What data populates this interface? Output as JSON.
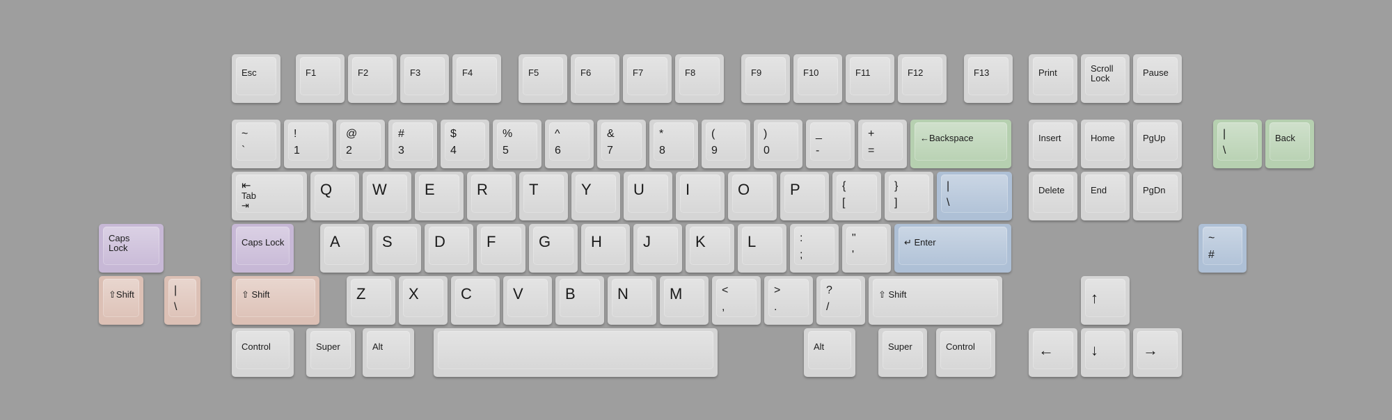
{
  "colors": {
    "background": "#9e9e9e",
    "key_gray": "#d5d5d5",
    "key_green": "#b6d0b0",
    "key_blue": "#aec0d6",
    "key_purple": "#c7b8d6",
    "key_peach": "#dcc0b5",
    "legend": "#1a1a1a"
  },
  "keys": [
    {
      "name": "esc",
      "label": "Esc",
      "color": "gray"
    },
    {
      "name": "f1",
      "label": "F1",
      "color": "gray"
    },
    {
      "name": "f2",
      "label": "F2",
      "color": "gray"
    },
    {
      "name": "f3",
      "label": "F3",
      "color": "gray"
    },
    {
      "name": "f4",
      "label": "F4",
      "color": "gray"
    },
    {
      "name": "f5",
      "label": "F5",
      "color": "gray"
    },
    {
      "name": "f6",
      "label": "F6",
      "color": "gray"
    },
    {
      "name": "f7",
      "label": "F7",
      "color": "gray"
    },
    {
      "name": "f8",
      "label": "F8",
      "color": "gray"
    },
    {
      "name": "f9",
      "label": "F9",
      "color": "gray"
    },
    {
      "name": "f10",
      "label": "F10",
      "color": "gray"
    },
    {
      "name": "f11",
      "label": "F11",
      "color": "gray"
    },
    {
      "name": "f12",
      "label": "F12",
      "color": "gray"
    },
    {
      "name": "f13",
      "label": "F13",
      "color": "gray"
    },
    {
      "name": "print",
      "label": "Print",
      "color": "gray"
    },
    {
      "name": "scroll-lock",
      "label": "Scroll\nLock",
      "color": "gray"
    },
    {
      "name": "pause",
      "label": "Pause",
      "color": "gray"
    },
    {
      "name": "tilde",
      "top": "~",
      "bottom": "`",
      "color": "gray"
    },
    {
      "name": "1",
      "top": "!",
      "bottom": "1",
      "color": "gray"
    },
    {
      "name": "2",
      "top": "@",
      "bottom": "2",
      "color": "gray"
    },
    {
      "name": "3",
      "top": "#",
      "bottom": "3",
      "color": "gray"
    },
    {
      "name": "4",
      "top": "$",
      "bottom": "4",
      "color": "gray"
    },
    {
      "name": "5",
      "top": "%",
      "bottom": "5",
      "color": "gray"
    },
    {
      "name": "6",
      "top": "^",
      "bottom": "6",
      "color": "gray"
    },
    {
      "name": "7",
      "top": "&",
      "bottom": "7",
      "color": "gray"
    },
    {
      "name": "8",
      "top": "*",
      "bottom": "8",
      "color": "gray"
    },
    {
      "name": "9",
      "top": "(",
      "bottom": "9",
      "color": "gray"
    },
    {
      "name": "0",
      "top": ")",
      "bottom": "0",
      "color": "gray"
    },
    {
      "name": "minus",
      "top": "_",
      "bottom": "-",
      "color": "gray"
    },
    {
      "name": "equal",
      "top": "+",
      "bottom": "=",
      "color": "gray"
    },
    {
      "name": "backspace",
      "label": "←Backspace",
      "color": "green"
    },
    {
      "name": "insert",
      "label": "Insert",
      "color": "gray"
    },
    {
      "name": "home",
      "label": "Home",
      "color": "gray"
    },
    {
      "name": "pgup",
      "label": "PgUp",
      "color": "gray"
    },
    {
      "name": "split-backslash",
      "top": "|",
      "bottom": "\\",
      "color": "green"
    },
    {
      "name": "back",
      "label": "Back",
      "color": "green"
    },
    {
      "name": "tab",
      "top": "⇤",
      "bottom": "Tab\n⇥",
      "color": "gray"
    },
    {
      "name": "q",
      "label": "Q",
      "color": "gray"
    },
    {
      "name": "w",
      "label": "W",
      "color": "gray"
    },
    {
      "name": "e",
      "label": "E",
      "color": "gray"
    },
    {
      "name": "r",
      "label": "R",
      "color": "gray"
    },
    {
      "name": "t",
      "label": "T",
      "color": "gray"
    },
    {
      "name": "y",
      "label": "Y",
      "color": "gray"
    },
    {
      "name": "u",
      "label": "U",
      "color": "gray"
    },
    {
      "name": "i",
      "label": "I",
      "color": "gray"
    },
    {
      "name": "o",
      "label": "O",
      "color": "gray"
    },
    {
      "name": "p",
      "label": "P",
      "color": "gray"
    },
    {
      "name": "lbracket",
      "top": "{",
      "bottom": "[",
      "color": "gray"
    },
    {
      "name": "rbracket",
      "top": "}",
      "bottom": "]",
      "color": "gray"
    },
    {
      "name": "backslash",
      "top": "|",
      "bottom": "\\",
      "color": "blue"
    },
    {
      "name": "delete",
      "label": "Delete",
      "color": "gray"
    },
    {
      "name": "end",
      "label": "End",
      "color": "gray"
    },
    {
      "name": "pgdn",
      "label": "PgDn",
      "color": "gray"
    },
    {
      "name": "iso-enter",
      "label": "Enter\n↵",
      "color": "blue"
    },
    {
      "name": "caps-lock-alt",
      "label": "Caps\nLock",
      "color": "purple"
    },
    {
      "name": "caps-lock",
      "label": "Caps Lock",
      "color": "purple"
    },
    {
      "name": "a",
      "label": "A",
      "color": "gray"
    },
    {
      "name": "s",
      "label": "S",
      "color": "gray"
    },
    {
      "name": "d",
      "label": "D",
      "color": "gray"
    },
    {
      "name": "f",
      "label": "F",
      "color": "gray"
    },
    {
      "name": "g",
      "label": "G",
      "color": "gray"
    },
    {
      "name": "h",
      "label": "H",
      "color": "gray"
    },
    {
      "name": "j",
      "label": "J",
      "color": "gray"
    },
    {
      "name": "k",
      "label": "K",
      "color": "gray"
    },
    {
      "name": "l",
      "label": "L",
      "color": "gray"
    },
    {
      "name": "semicolon",
      "top": ":",
      "bottom": ";",
      "color": "gray"
    },
    {
      "name": "quote",
      "top": "\"",
      "bottom": "'",
      "color": "gray"
    },
    {
      "name": "enter",
      "label": "↵ Enter",
      "color": "blue"
    },
    {
      "name": "iso-hash",
      "top": "~",
      "bottom": "#",
      "color": "blue"
    },
    {
      "name": "shift-left-short",
      "label": "⇧Shift",
      "color": "peach"
    },
    {
      "name": "iso-backslash",
      "top": "|",
      "bottom": "\\",
      "color": "peach"
    },
    {
      "name": "shift-left",
      "label": "⇧ Shift",
      "color": "peach"
    },
    {
      "name": "z",
      "label": "Z",
      "color": "gray"
    },
    {
      "name": "x",
      "label": "X",
      "color": "gray"
    },
    {
      "name": "c",
      "label": "C",
      "color": "gray"
    },
    {
      "name": "v",
      "label": "V",
      "color": "gray"
    },
    {
      "name": "b",
      "label": "B",
      "color": "gray"
    },
    {
      "name": "n",
      "label": "N",
      "color": "gray"
    },
    {
      "name": "m",
      "label": "M",
      "color": "gray"
    },
    {
      "name": "comma",
      "top": "<",
      "bottom": ",",
      "color": "gray"
    },
    {
      "name": "period",
      "top": ">",
      "bottom": ".",
      "color": "gray"
    },
    {
      "name": "slash",
      "top": "?",
      "bottom": "/",
      "color": "gray"
    },
    {
      "name": "shift-right",
      "label": "⇧ Shift",
      "color": "gray"
    },
    {
      "name": "arrow-up",
      "label": "↑",
      "color": "gray"
    },
    {
      "name": "control-left",
      "label": "Control",
      "color": "gray"
    },
    {
      "name": "super-left",
      "label": "Super",
      "color": "gray"
    },
    {
      "name": "alt-left",
      "label": "Alt",
      "color": "gray"
    },
    {
      "name": "space",
      "label": "",
      "color": "gray"
    },
    {
      "name": "alt-right",
      "label": "Alt",
      "color": "gray"
    },
    {
      "name": "super-right",
      "label": "Super",
      "color": "gray"
    },
    {
      "name": "control-right",
      "label": "Control",
      "color": "gray"
    },
    {
      "name": "arrow-left",
      "label": "←",
      "color": "gray"
    },
    {
      "name": "arrow-down",
      "label": "↓",
      "color": "gray"
    },
    {
      "name": "arrow-right",
      "label": "→",
      "color": "gray"
    }
  ]
}
